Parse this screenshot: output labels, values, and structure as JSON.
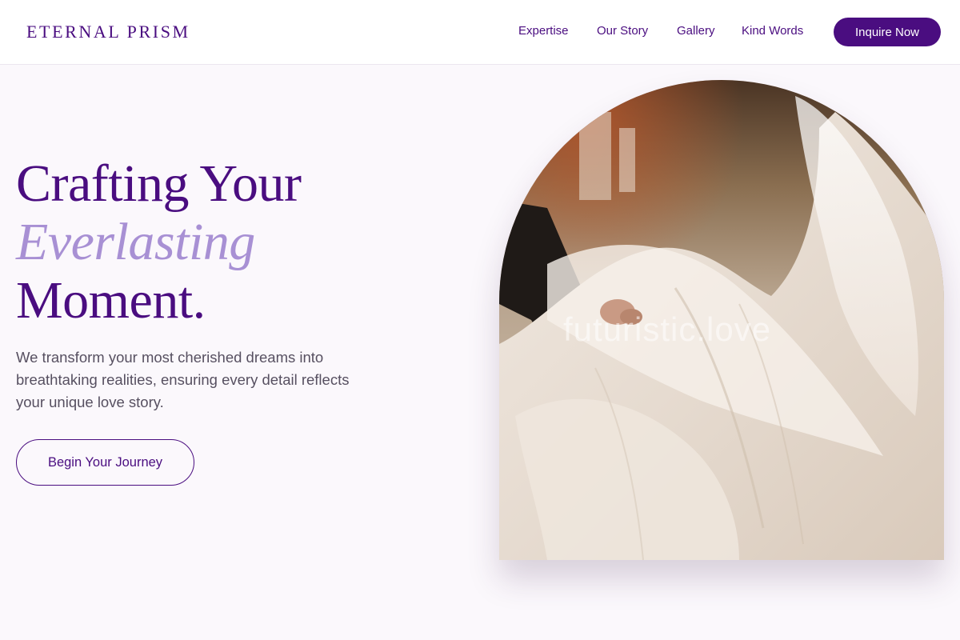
{
  "header": {
    "logo": "ETERNAL PRISM",
    "nav": {
      "expertise": "Expertise",
      "story": "Our Story",
      "gallery": "Gallery",
      "kind_words": "Kind Words"
    },
    "cta": "Inquire Now"
  },
  "hero": {
    "title_line1": "Crafting Your",
    "title_accent": "Everlasting",
    "title_line3": "Moment.",
    "description": "We transform your most cherished dreams into breathtaking realities, ensuring every detail reflects your unique love story.",
    "button": "Begin Your Journey",
    "image_watermark": "futuristic.love"
  },
  "colors": {
    "brand": "#4a0d80",
    "accent": "#a890d4",
    "background": "#fbf8fc",
    "body_text": "#575061"
  }
}
